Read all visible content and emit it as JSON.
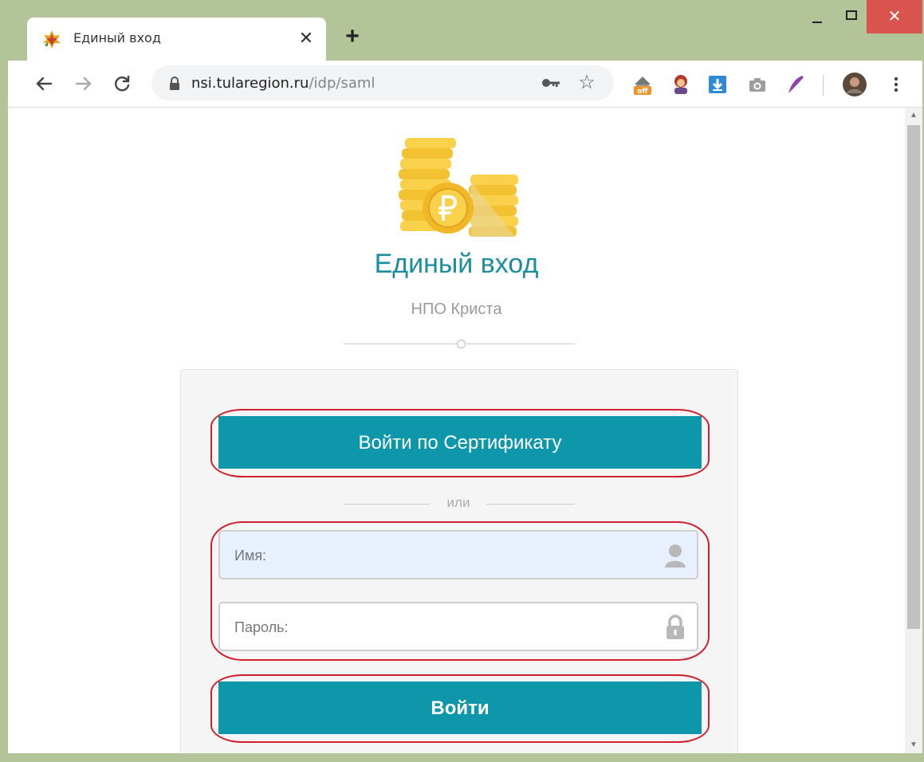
{
  "browser": {
    "tab_title": "Единый вход",
    "tab_close": "✕",
    "new_tab": "+",
    "url_host": "nsi.tularegion.ru",
    "url_path": "/idp/saml",
    "window_close": "✕"
  },
  "page": {
    "title": "Единый вход",
    "subtitle": "НПО Криста",
    "certificate_button_label": "Войти по Сертификату",
    "or_label": "или",
    "username_placeholder": "Имя:",
    "password_placeholder": "Пароль:",
    "login_button_label": "Войти"
  },
  "colors": {
    "accent": "#0e96aa",
    "title": "#1a8e9e",
    "highlight_outline": "#d0202e",
    "frame": "#b2c498"
  },
  "icons": {
    "logo": "gold-coins-ruble-icon",
    "username_field": "user-icon",
    "password_field": "padlock-icon"
  }
}
